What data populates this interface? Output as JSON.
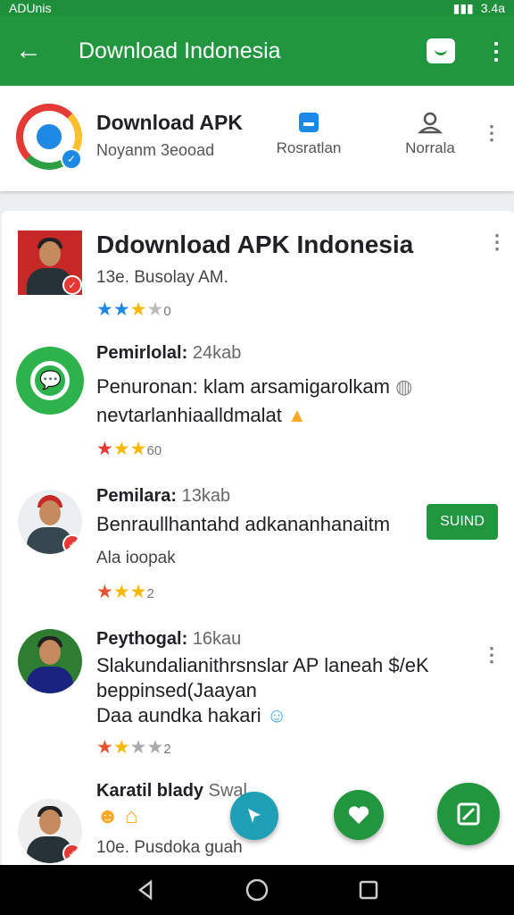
{
  "status_bar": {
    "carrier": "ADUnis",
    "time": "3.4a"
  },
  "app_bar": {
    "title": "Download Indonesia",
    "back_icon": "arrow-left-icon",
    "chat_icon": "chat-icon",
    "more_icon": "more-vert-icon"
  },
  "header": {
    "title": "Download APK",
    "subtitle": "Noyanm 3eooad",
    "stats": [
      {
        "label": "Rosratlan",
        "icon": "bookmark-icon"
      },
      {
        "label": "Norrala",
        "icon": "person-icon"
      }
    ]
  },
  "list": {
    "featured": {
      "title": "Ddownload APK Indonesia",
      "meta": "13e. Busolay AM.",
      "rating": "0",
      "stars": 3
    },
    "items": [
      {
        "name": "Pemirlolal:",
        "size": "24kab",
        "desc1": "Penuronan: klam arsamigarolkam",
        "desc2": "nevtarlanhiaalldmalat",
        "rating": "60",
        "stars": 3,
        "star_color": "#e53935"
      },
      {
        "name": "Pemilara:",
        "size": "13kab",
        "desc1": "Benraullhantahd adkananhanaitm",
        "meta": "Ala ioopak",
        "rating": "2",
        "stars": 3,
        "star_color": "#e55330",
        "button": "SUIND"
      },
      {
        "name": "Peythogal:",
        "size": "16kau",
        "desc1": "Slakundalianithrsnslar AP laneah $/eK",
        "desc2": "beppinsed(Jaayan",
        "desc3": "Daa aundka hakari",
        "rating": "2",
        "stars": 2,
        "star_color": "#e55330"
      },
      {
        "name": "Karatil blady",
        "size": "Swal",
        "meta": "10e. Pusdoka guah"
      }
    ]
  },
  "fabs": [
    "cursor-icon",
    "heart-icon",
    "edit-icon"
  ],
  "colors": {
    "primary": "#21963f",
    "accent_blue": "#1e88e5",
    "star_yellow": "#f9b800"
  }
}
